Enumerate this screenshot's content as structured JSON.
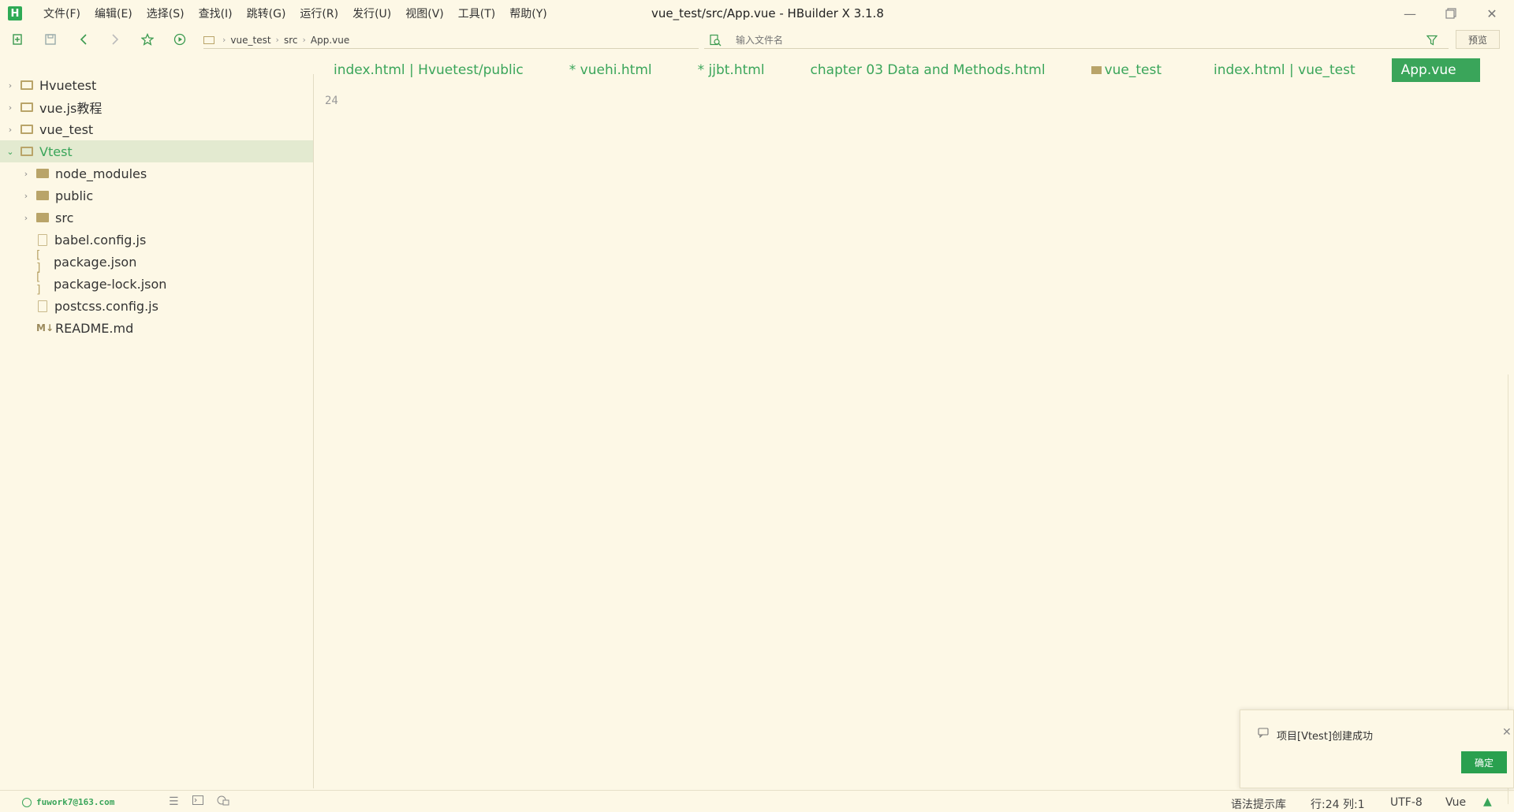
{
  "window": {
    "logo": "H",
    "title": "vue_test/src/App.vue - HBuilder X 3.1.8",
    "menu": [
      "文件(F)",
      "编辑(E)",
      "选择(S)",
      "查找(I)",
      "跳转(G)",
      "运行(R)",
      "发行(U)",
      "视图(V)",
      "工具(T)",
      "帮助(Y)"
    ]
  },
  "toolbar": {
    "breadcrumb": [
      "vue_test",
      "src",
      "App.vue"
    ],
    "search_placeholder": "输入文件名",
    "preview_label": "预览"
  },
  "sidebar": {
    "items": [
      {
        "label": "Hvuetest",
        "type": "project"
      },
      {
        "label": "vue.js教程",
        "type": "project"
      },
      {
        "label": "vue_test",
        "type": "project"
      },
      {
        "label": "Vtest",
        "type": "project",
        "expanded": true,
        "active": true
      },
      {
        "label": "node_modules",
        "type": "folder"
      },
      {
        "label": "public",
        "type": "folder"
      },
      {
        "label": "src",
        "type": "folder"
      },
      {
        "label": "babel.config.js",
        "type": "js"
      },
      {
        "label": "package.json",
        "type": "json"
      },
      {
        "label": "package-lock.json",
        "type": "json"
      },
      {
        "label": "postcss.config.js",
        "type": "js"
      },
      {
        "label": "README.md",
        "type": "md"
      }
    ]
  },
  "tabs": [
    {
      "label": "index.html | Hvuetest/public"
    },
    {
      "label": "* vuehi.html"
    },
    {
      "label": "* jjbt.html"
    },
    {
      "label": "chapter 03 Data and Methods.html"
    },
    {
      "label": "vue_test"
    },
    {
      "label": "index.html | vue_test"
    },
    {
      "label": "App.vue",
      "active": true
    }
  ],
  "editor": {
    "line_number": "24"
  },
  "notification": {
    "message": "项目[Vtest]创建成功",
    "ok_label": "确定"
  },
  "statusbar": {
    "account": "fuwork7@163.com",
    "syntax_label": "语法提示库",
    "position": "行:24  列:1",
    "encoding": "UTF-8",
    "language": "Vue"
  },
  "colors": {
    "background": "#fdf8e6",
    "accent": "#3aa55a"
  }
}
